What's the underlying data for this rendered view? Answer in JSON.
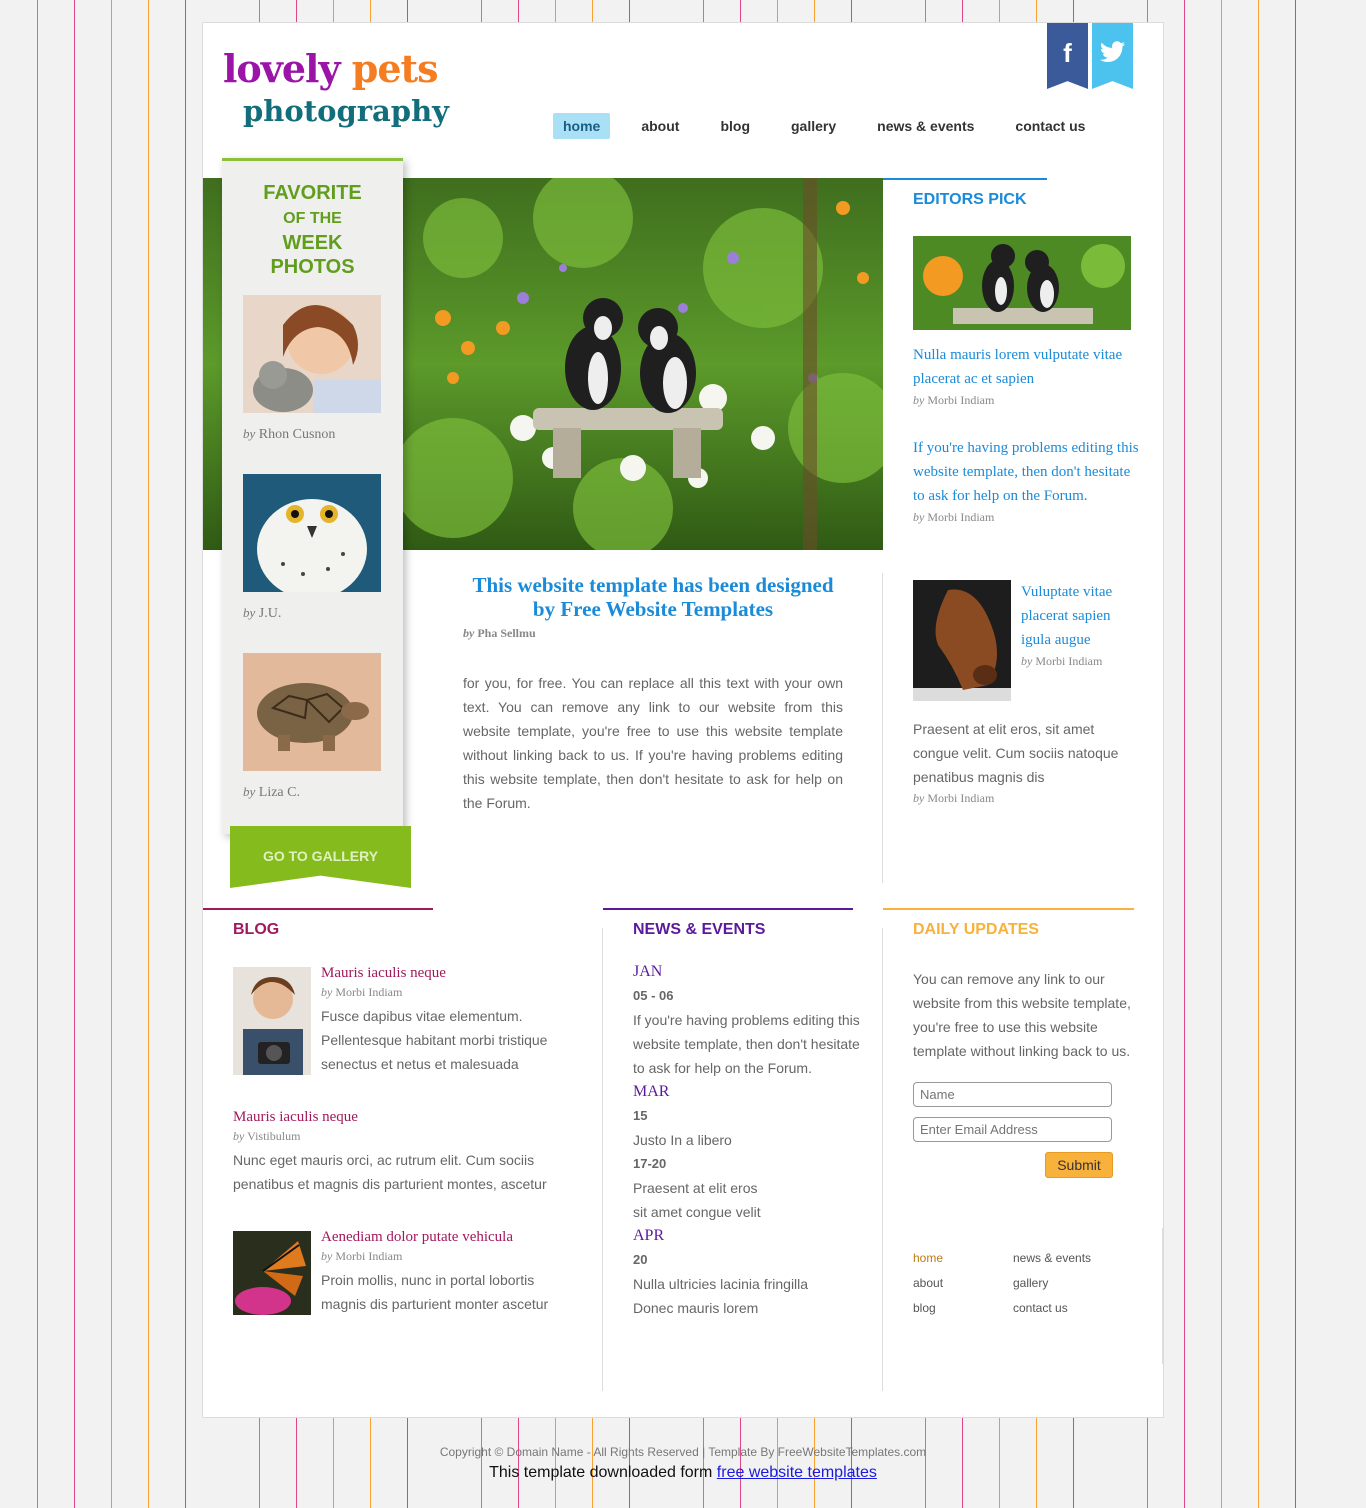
{
  "logo": {
    "word1": "lovely",
    "word2": "pets",
    "word3": "photography"
  },
  "social": {
    "facebook": "f",
    "twitter": "t"
  },
  "nav": [
    "home",
    "about",
    "blog",
    "gallery",
    "news & events",
    "contact us"
  ],
  "favorite": {
    "title1": "FAVORITE",
    "title2": "OF THE",
    "title3": "WEEK",
    "title4": "PHOTOS",
    "items": [
      {
        "by": "by",
        "name": "Rhon Cusnon"
      },
      {
        "by": "by",
        "name": "J.U."
      },
      {
        "by": "by",
        "name": "Liza C."
      }
    ],
    "button": "GO TO GALLERY"
  },
  "article": {
    "title": "This website template has been designed by Free Website Templates",
    "by": "by",
    "author": "Pha Sellmu",
    "body": "for you, for free. You can replace all this text with your own text. You can remove any link to our website from this website template, you're free to use this website template without linking back to us. If you're having problems editing this website template, then don't hesitate to ask for help on the Forum."
  },
  "editors_pick": {
    "heading": "EDITORS PICK",
    "items": [
      {
        "title": "Nulla mauris lorem vulputate vitae placerat ac et sapien",
        "by": "by",
        "author": "Morbi Indiam"
      },
      {
        "title": "If you're having problems editing this website template, then don't hesitate to ask for help on the Forum.",
        "by": "by",
        "author": "Morbi Indiam"
      },
      {
        "title": "Vuluptate vitae placerat sapien igula augue",
        "by": "by",
        "author": "Morbi Indiam"
      }
    ],
    "paragraph": "Praesent at elit eros, sit amet congue velit. Cum sociis natoque penatibus magnis dis",
    "paragraph_by": "by",
    "paragraph_author": "Morbi Indiam"
  },
  "blog": {
    "heading": "BLOG",
    "items": [
      {
        "title": "Mauris iaculis neque",
        "by": "by",
        "author": "Morbi Indiam",
        "text": "Fusce dapibus vitae elementum. Pellentesque habitant morbi tristique senectus et netus et malesuada"
      },
      {
        "title": "Mauris iaculis neque",
        "by": "by",
        "author": "Vistibulum",
        "text": "Nunc eget mauris orci, ac rutrum elit. Cum sociis penatibus et magnis dis parturient montes, ascetur"
      },
      {
        "title": "Aenediam dolor putate vehicula",
        "by": "by",
        "author": "Morbi Indiam",
        "text": "Proin mollis, nunc in portal lobortis magnis dis parturient monter ascetur"
      }
    ]
  },
  "news": {
    "heading": "NEWS & EVENTS",
    "jan": "JAN",
    "jan_d": "05 - 06",
    "jan_t": "If you're having problems editing this website template, then don't hesitate to ask for help on the Forum.",
    "mar": "MAR",
    "mar_d1": "15",
    "mar_t1": "Justo In a libero",
    "mar_d2": "17-20",
    "mar_t2a": "Praesent at elit eros",
    "mar_t2b": "sit amet congue velit",
    "apr": "APR",
    "apr_d": "20",
    "apr_t1": "Nulla ultricies lacinia fringilla",
    "apr_t2": "Donec mauris lorem"
  },
  "daily": {
    "heading": "DAILY UPDATES",
    "text": "You can remove any link to our website from this website template, you're free to use this website template without linking back to us.",
    "name_placeholder": "Name",
    "email_placeholder": "Enter Email Address",
    "submit": "Submit"
  },
  "footer_links": [
    "home",
    "news & events",
    "about",
    "gallery",
    "blog",
    "contact us"
  ],
  "copyright": "Copyright © Domain Name - All Rights Reserved | Template By FreeWebsiteTemplates.com",
  "download_text": "This template downloaded form",
  "download_link": "free website templates",
  "colors": {
    "orange": "#f57c1f",
    "purple": "#9b14a8",
    "teal": "#126e7b",
    "blue": "#1a8bd8",
    "green": "#86bb1d",
    "blog": "#a1195d",
    "news": "#5b1a9c",
    "daily": "#f8b13b"
  }
}
